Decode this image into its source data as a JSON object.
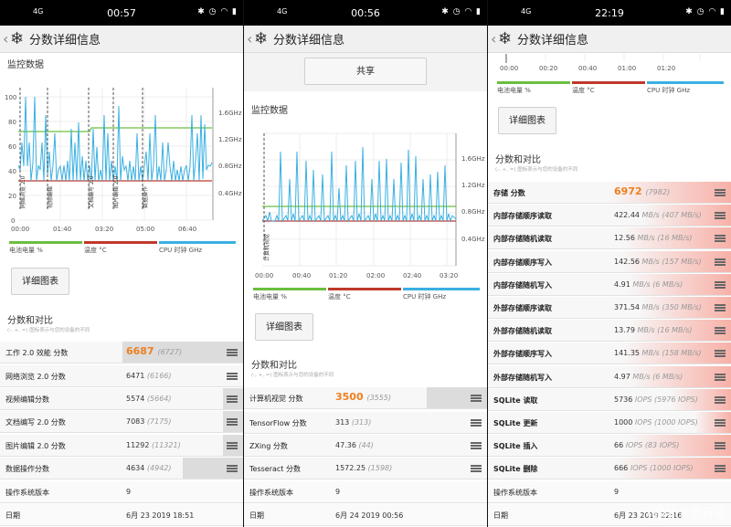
{
  "screens": [
    {
      "status_left": "4G",
      "time": "00:57",
      "status_right": "✱ ◷ ◠ ▮",
      "title": "分数详细信息",
      "monitor_label": "监控数据",
      "y_ticks": [
        "100",
        "80",
        "60",
        "40",
        "20",
        "0"
      ],
      "ghz_ticks": [
        "1.6GHz",
        "1.2GHz",
        "0.8GHz",
        "0.4GHz"
      ],
      "x_ticks": [
        "00:00",
        "01:40",
        "03:20",
        "05:00",
        "06:40"
      ],
      "vert_labels": [
        "网络浏览 2.0",
        "视频编辑",
        "文档编写 2.0",
        "图片编辑 2.0",
        "数据操作"
      ],
      "legend": [
        "电池电量 %",
        "温度 °C",
        "CPU 时钟 GHz"
      ],
      "detail_button": "详细图表",
      "compare_title": "分数和对比",
      "compare_hint": "(-, +, =) 图标表示与您的设备的不同",
      "rows": [
        {
          "k": "工作 2.0 效能 分数",
          "v": "6687",
          "p": "(6727)",
          "big": true,
          "bar": 0.47
        },
        {
          "k": "网络浏览 2.0 分数",
          "v": "6471",
          "p": "(6166)",
          "bar": 0
        },
        {
          "k": "视频编辑分数",
          "v": "5574",
          "p": "(5664)",
          "bar": 0.02
        },
        {
          "k": "文档编写 2.0 分数",
          "v": "7083",
          "p": "(7175)",
          "bar": 0.02
        },
        {
          "k": "图片编辑 2.0 分数",
          "v": "11292",
          "p": "(11321)",
          "bar": 0.02
        },
        {
          "k": "数据操作分数",
          "v": "4634",
          "p": "(4942)",
          "bar": 0.2
        }
      ],
      "os_label": "操作系统版本",
      "os_value": "9",
      "date_label": "日期",
      "date_value": "6月 23 2019 18:51"
    },
    {
      "status_left": "4G",
      "time": "00:56",
      "status_right": "✱ ◷ ◠ ▮",
      "title": "分数详细信息",
      "share_button": "共享",
      "monitor_label": "监控数据",
      "ghz_ticks": [
        "1.6GHz",
        "1.2GHz",
        "0.8GHz",
        "0.4GHz"
      ],
      "x_ticks": [
        "00:00",
        "00:40",
        "01:20",
        "02:00",
        "02:40",
        "03:20"
      ],
      "vert_labels": [
        "计算机视觉"
      ],
      "legend": [
        "电池电量 %",
        "温度 °C",
        "CPU 时钟 GHz"
      ],
      "detail_button": "详细图表",
      "compare_title": "分数和对比",
      "compare_hint": "(-, +, =) 图标表示与您的设备的不同",
      "rows": [
        {
          "k": "计算机视觉 分数",
          "v": "3500",
          "p": "(3555)",
          "big": true,
          "bar": 0.2
        },
        {
          "k": "TensorFlow 分数",
          "v": "313",
          "p": "(313)",
          "bar": 0
        },
        {
          "k": "ZXing 分数",
          "v": "47.36",
          "p": "(44)",
          "bar": 0
        },
        {
          "k": "Tesseract 分数",
          "v": "1572.25",
          "p": "(1598)",
          "bar": 0
        }
      ],
      "os_label": "操作系统版本",
      "os_value": "9",
      "date_label": "日期",
      "date_value": "6月 24 2019 00:56"
    },
    {
      "status_left": "4G",
      "time": "22:19",
      "status_right": "✱ ◷ ◠ ▮",
      "title": "分数详细信息",
      "x_ticks": [
        "00:00",
        "00:20",
        "00:40",
        "01:00",
        "01:20"
      ],
      "legend": [
        "电池电量 %",
        "温度 °C",
        "CPU 时钟 GHz"
      ],
      "detail_button": "详细图表",
      "compare_title": "分数和对比",
      "compare_hint": "(-, +, =) 图标表示与您的设备的不同",
      "rows": [
        {
          "k": "存储 分数",
          "v": "6972",
          "p": "(7982)",
          "big": true,
          "bar": 1.0
        },
        {
          "k": "内部存储顺序读取",
          "v": "422.44",
          "u": "MB/s",
          "p": "(407 MB/s)",
          "bar": 0.75
        },
        {
          "k": "内部存储随机读取",
          "v": "12.56",
          "u": "MB/s",
          "p": "(16 MB/s)",
          "bar": 0.9
        },
        {
          "k": "内部存储顺序写入",
          "v": "142.56",
          "u": "MB/s",
          "p": "(157 MB/s)",
          "bar": 0.9
        },
        {
          "k": "内部存储随机写入",
          "v": "4.91",
          "u": "MB/s",
          "p": "(6 MB/s)",
          "bar": 0.85
        },
        {
          "k": "外部存储顺序读取",
          "v": "371.54",
          "u": "MB/s",
          "p": "(350 MB/s)",
          "bar": 0.75
        },
        {
          "k": "外部存储随机读取",
          "v": "13.79",
          "u": "MB/s",
          "p": "(16 MB/s)",
          "bar": 0.85
        },
        {
          "k": "外部存储顺序写入",
          "v": "141.35",
          "u": "MB/s",
          "p": "(158 MB/s)",
          "bar": 0.9
        },
        {
          "k": "外部存储随机写入",
          "v": "4.97",
          "u": "MB/s",
          "p": "(6 MB/s)",
          "bar": 0.85
        },
        {
          "k": "SQLite 读取",
          "v": "5736",
          "u": "IOPS",
          "p": "(5976 IOPS)",
          "bar": 0.5
        },
        {
          "k": "SQLite 更新",
          "v": "1000",
          "u": "IOPS",
          "p": "(1000 IOPS)",
          "bar": 0.3
        },
        {
          "k": "SQLite 插入",
          "v": "66",
          "u": "IOPS",
          "p": "(83 IOPS)",
          "bar": 0.85
        },
        {
          "k": "SQLite 删除",
          "v": "666",
          "u": "IOPS",
          "p": "(1000 IOPS)",
          "bar": 0.95
        }
      ],
      "os_label": "操作系统版本",
      "os_value": "9",
      "date_label": "日期",
      "date_value": "6月 23 2019 22:16"
    }
  ],
  "watermark": "什么值得买",
  "watermark_icon": "值",
  "colors": {
    "battery": "#6abf40",
    "temp": "#c0392b",
    "cpu": "#3ab0e2",
    "accent": "#ee7f1f",
    "worse": "#f7b1a8"
  }
}
